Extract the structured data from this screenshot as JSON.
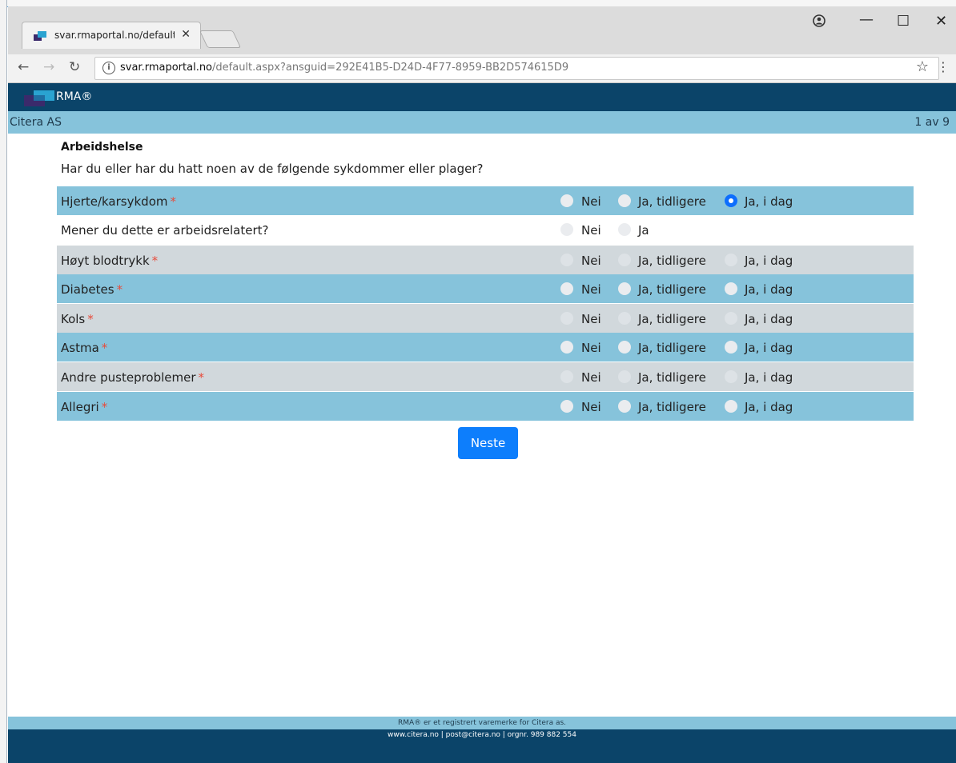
{
  "browser": {
    "tab_title": "svar.rmaportal.no/default",
    "url_host": "svar.rmaportal.no",
    "url_path": "/default.aspx?ansguid=292E41B5-D24D-4F77-8959-BB2D574615D9"
  },
  "header": {
    "brand": "RMA®"
  },
  "subbar": {
    "company": "Citera AS",
    "pager": "1 av 9"
  },
  "survey": {
    "section_title": "Arbeidshelse",
    "question": "Har du eller har du hatt noen av de følgende sykdommer eller plager?",
    "options": {
      "nei": "Nei",
      "tidligere": "Ja, tidligere",
      "idag": "Ja, i dag",
      "ja": "Ja"
    },
    "rows": [
      {
        "label": "Hjerte/karsykdom",
        "required": "*",
        "selected": "Ja, i dag"
      },
      {
        "label": "Mener du dette er arbeidsrelatert?",
        "selected": ""
      },
      {
        "label": "Høyt blodtrykk",
        "required": "*",
        "selected": ""
      },
      {
        "label": "Diabetes",
        "required": "*",
        "selected": ""
      },
      {
        "label": "Kols",
        "required": "*",
        "selected": ""
      },
      {
        "label": "Astma",
        "required": "*",
        "selected": ""
      },
      {
        "label": "Andre pusteproblemer",
        "required": "*",
        "selected": ""
      },
      {
        "label": "Allegri",
        "required": "*",
        "selected": ""
      }
    ],
    "next_button": "Neste"
  },
  "footer": {
    "line1": "RMA® er et registrert varemerke for Citera as.",
    "line2": "www.citera.no | post@citera.no | orgnr. 989 882 554"
  },
  "colors": {
    "header": "#0b4469",
    "subbar": "#86c3db",
    "accent": "#0d7efc",
    "required": "#e74c3c"
  }
}
